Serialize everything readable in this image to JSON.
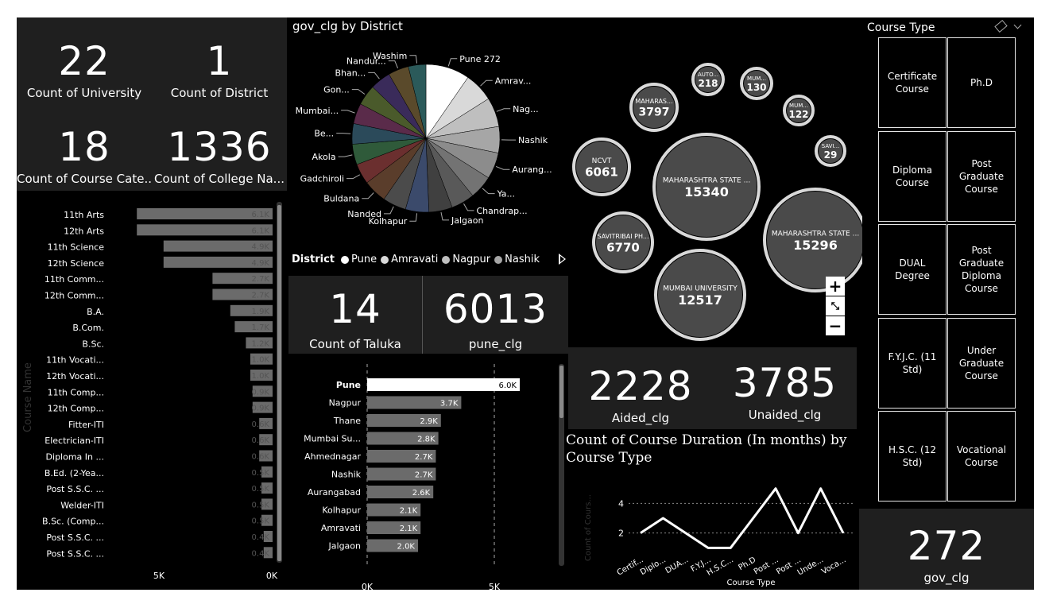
{
  "kpis": {
    "university": {
      "value": "22",
      "label": "Count of University"
    },
    "district": {
      "value": "1",
      "label": "Count of District"
    },
    "course_cat": {
      "value": "18",
      "label": "Count of Course Cate..."
    },
    "college": {
      "value": "1336",
      "label": "Count of College Na..."
    },
    "taluka": {
      "value": "14",
      "label": "Count of Taluka"
    },
    "pune_clg": {
      "value": "6013",
      "label": "pune_clg"
    },
    "aided": {
      "value": "2228",
      "label": "Aided_clg"
    },
    "unaided": {
      "value": "3785",
      "label": "Unaided_clg"
    },
    "gov": {
      "value": "272",
      "label": "gov_clg"
    }
  },
  "course_chart": {
    "axis_title": "Course Name",
    "tick_left": "5K",
    "tick_right": "0K",
    "items": [
      {
        "label": "11th Arts",
        "value": 6.1,
        "data_label": "6.1K"
      },
      {
        "label": "12th Arts",
        "value": 6.1,
        "data_label": "6.1K"
      },
      {
        "label": "11th Science",
        "value": 4.9,
        "data_label": "4.9K"
      },
      {
        "label": "12th Science",
        "value": 4.9,
        "data_label": "4.9K"
      },
      {
        "label": "11th Comm...",
        "value": 2.7,
        "data_label": "2.7K"
      },
      {
        "label": "12th Comm...",
        "value": 2.7,
        "data_label": "2.7K"
      },
      {
        "label": "B.A.",
        "value": 1.9,
        "data_label": "1.9K"
      },
      {
        "label": "B.Com.",
        "value": 1.7,
        "data_label": "1.7K"
      },
      {
        "label": "B.Sc.",
        "value": 1.2,
        "data_label": "1.2K"
      },
      {
        "label": "11th Vocati...",
        "value": 1.0,
        "data_label": "1.0K"
      },
      {
        "label": "12th Vocati...",
        "value": 1.0,
        "data_label": "1.0K"
      },
      {
        "label": "11th Comp...",
        "value": 0.9,
        "data_label": "0.9K"
      },
      {
        "label": "12th Comp...",
        "value": 0.9,
        "data_label": "0.9K"
      },
      {
        "label": "Fitter-ITI",
        "value": 0.6,
        "data_label": "0.6K"
      },
      {
        "label": "Electrician-ITI",
        "value": 0.6,
        "data_label": "0.6K"
      },
      {
        "label": "Diploma In ...",
        "value": 0.6,
        "data_label": "0.6K"
      },
      {
        "label": "B.Ed. (2-Yea...",
        "value": 0.5,
        "data_label": "0.5K"
      },
      {
        "label": "Post S.S.C. ...",
        "value": 0.5,
        "data_label": "0.5K"
      },
      {
        "label": "Welder-ITI",
        "value": 0.5,
        "data_label": "0.5K"
      },
      {
        "label": "B.Sc. (Comp...",
        "value": 0.5,
        "data_label": "0.5K"
      },
      {
        "label": "Post S.S.C. ...",
        "value": 0.4,
        "data_label": "0.4K"
      },
      {
        "label": "Post S.S.C. ...",
        "value": 0.4,
        "data_label": "0.4K"
      }
    ]
  },
  "pie": {
    "title": "gov_clg by District",
    "labels": [
      {
        "text": "Pune 272",
        "color": "#ffffff",
        "share": 0.075
      },
      {
        "text": "Amrav...",
        "color": "#d9d9d9",
        "share": 0.05
      },
      {
        "text": "Nag...",
        "color": "#bfbfbf",
        "share": 0.05
      },
      {
        "text": "Nashik",
        "color": "#a6a6a6",
        "share": 0.045
      },
      {
        "text": "Aurang...",
        "color": "#8c8c8c",
        "share": 0.045
      },
      {
        "text": "Ya...",
        "color": "#737373",
        "share": 0.04
      },
      {
        "text": "Chandrap...",
        "color": "#595959",
        "share": 0.04
      },
      {
        "text": "Jalgaon",
        "color": "#404040",
        "share": 0.04
      },
      {
        "text": "Kolhapur",
        "color": "#3b4a6b",
        "share": 0.04
      },
      {
        "text": "Nanded",
        "color": "#4b4b4b",
        "share": 0.04
      },
      {
        "text": "Buldana",
        "color": "#5a3d2b",
        "share": 0.04
      },
      {
        "text": "Gadchiroli",
        "color": "#6b2f2f",
        "share": 0.035
      },
      {
        "text": "Akola",
        "color": "#2f5a3a",
        "share": 0.035
      },
      {
        "text": "Be...",
        "color": "#2b4a5a",
        "share": 0.035
      },
      {
        "text": "Mumbai...",
        "color": "#5a2b4a",
        "share": 0.035
      },
      {
        "text": "Gon...",
        "color": "#4a5a2b",
        "share": 0.035
      },
      {
        "text": "Bhan...",
        "color": "#3a2b5a",
        "share": 0.035
      },
      {
        "text": "Nandur...",
        "color": "#5a4a2b",
        "share": 0.035
      },
      {
        "text": "Washim",
        "color": "#2b5a5a",
        "share": 0.03
      }
    ]
  },
  "legend": {
    "title": "District",
    "items": [
      {
        "text": "Pune",
        "color": "#ffffff"
      },
      {
        "text": "Amravati",
        "color": "#d9d9d9"
      },
      {
        "text": "Nagpur",
        "color": "#bfbfbf"
      },
      {
        "text": "Nashik",
        "color": "#a6a6a6"
      }
    ]
  },
  "district_chart": {
    "tick_left": "0K",
    "tick_right": "5K",
    "items": [
      {
        "label": "Pune",
        "value": 6.0,
        "data_label": "6.0K",
        "highlight": true
      },
      {
        "label": "Nagpur",
        "value": 3.7,
        "data_label": "3.7K"
      },
      {
        "label": "Thane",
        "value": 2.9,
        "data_label": "2.9K"
      },
      {
        "label": "Mumbai Su...",
        "value": 2.8,
        "data_label": "2.8K"
      },
      {
        "label": "Ahmednagar",
        "value": 2.7,
        "data_label": "2.7K"
      },
      {
        "label": "Nashik",
        "value": 2.7,
        "data_label": "2.7K"
      },
      {
        "label": "Aurangabad",
        "value": 2.6,
        "data_label": "2.6K"
      },
      {
        "label": "Kolhapur",
        "value": 2.1,
        "data_label": "2.1K"
      },
      {
        "label": "Amravati",
        "value": 2.1,
        "data_label": "2.1K"
      },
      {
        "label": "Jalgaon",
        "value": 2.0,
        "data_label": "2.0K"
      }
    ]
  },
  "bubbles": [
    {
      "name": "MAHARASHTRA STATE ...",
      "value": "15340"
    },
    {
      "name": "MAHARASHTRA STATE ...",
      "value": "15296"
    },
    {
      "name": "MUMBAI UNIVERSITY",
      "value": "12517"
    },
    {
      "name": "SAVITRIBAI PH...",
      "value": "6770"
    },
    {
      "name": "NCVT",
      "value": "6061"
    },
    {
      "name": "MAHARAS...",
      "value": "3797"
    },
    {
      "name": "AUTO...",
      "value": "218"
    },
    {
      "name": "MUM...",
      "value": "130"
    },
    {
      "name": "MUM...",
      "value": "122"
    },
    {
      "name": "SAVI...",
      "value": "29"
    }
  ],
  "line_chart": {
    "title": "Count of Course Duration (In months) by Course Type",
    "xlabel": "Course Type",
    "ylabel": "Count of Cours...",
    "yticks": [
      "4",
      "2"
    ],
    "ylim": [
      0,
      6
    ],
    "x": [
      "Certif...",
      "Diplo...",
      "DUA...",
      "F.Y.J...",
      "H.S.C...",
      "Ph.D",
      "Post ...",
      "Post ...",
      "Unde...",
      "Voca..."
    ],
    "values": [
      2,
      3,
      2,
      1,
      1,
      3,
      5,
      2,
      5,
      2
    ]
  },
  "slicer": {
    "title": "Course Type",
    "buttons": [
      "Certificate Course",
      "Ph.D",
      "Diploma Course",
      "Post Graduate Course",
      "DUAL Degree",
      "Post Graduate Diploma Course",
      "F.Y.J.C. (11 Std)",
      "Under Graduate Course",
      "H.S.C. (12 Std)",
      "Vocational Course"
    ]
  },
  "colors": {
    "bar": "#6b6b6b",
    "accent": "#ffffff",
    "tile": "#1f1f1f"
  }
}
